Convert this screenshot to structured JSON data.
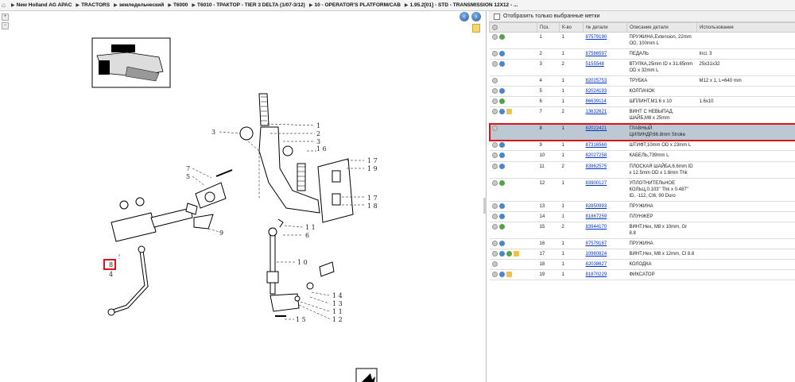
{
  "breadcrumb": [
    "New Holland AG APAC",
    "TRACTORS",
    "земледельческий",
    "T6000",
    "T6010 - ТРАКТОР - TIER 3 DELTA (1/07-3/12)",
    "10 - OPERATOR'S PLATFORM/CAB",
    "1.95.2[01] - STD - TRANSMISSION 12X12 - ..."
  ],
  "filter_label": "Отобразить только выбранные метки",
  "columns": [
    "Поз.",
    "К-во",
    "№ детали",
    "Описание детали",
    "Использование"
  ],
  "rows": [
    {
      "icons": [
        "info",
        "green"
      ],
      "pos": "1",
      "qty": "1",
      "part": "87579190",
      "desc": "ПРУЖИНА,Extension, 22mm OD, 100mm L",
      "use": ""
    },
    {
      "icons": [
        "info",
        "blue"
      ],
      "pos": "2",
      "qty": "1",
      "part": "87586597",
      "desc": "ПЕДАЛЬ",
      "use": "Incl. 3"
    },
    {
      "icons": [
        "info",
        "blue"
      ],
      "pos": "3",
      "qty": "2",
      "part": "5155548",
      "desc": "ВТУЛКА,25mm ID x 31.85mm OD x 32mm L",
      "use": "25x31x32"
    },
    {
      "icons": [
        "info"
      ],
      "pos": "4",
      "qty": "1",
      "part": "82025753",
      "desc": "ТРУБКА",
      "use": "M12 x 1, L=640 mm"
    },
    {
      "icons": [
        "info",
        "blue"
      ],
      "pos": "5",
      "qty": "1",
      "part": "82024193",
      "desc": "КОЛПАЧОК",
      "use": ""
    },
    {
      "icons": [
        "info",
        "green"
      ],
      "pos": "6",
      "qty": "1",
      "part": "86639114",
      "desc": "ШПЛИНТ,M1.6 x 10",
      "use": "1.6x10"
    },
    {
      "icons": [
        "info",
        "blue",
        "box"
      ],
      "pos": "7",
      "qty": "2",
      "part": "13632621",
      "desc": "ВИНТ С НЕВЫПАД. ШАЙБ,M8 x 25mm",
      "use": ""
    },
    {
      "icons": [
        "info"
      ],
      "pos": "8",
      "qty": "1",
      "part": "82022421",
      "desc": "ГЛАВНЫЙ ЦИЛИНДР,66.8mm Stroke",
      "use": "",
      "selected": true
    },
    {
      "icons": [
        "info",
        "blue"
      ],
      "pos": "9",
      "qty": "1",
      "part": "87316560",
      "desc": "ШТИФТ,10mm OD x 23mm L",
      "use": ""
    },
    {
      "icons": [
        "info",
        "blue"
      ],
      "pos": "10",
      "qty": "1",
      "part": "82027258",
      "desc": "КАБЕЛЬ,739mm L",
      "use": ""
    },
    {
      "icons": [
        "info",
        "blue"
      ],
      "pos": "11",
      "qty": "2",
      "part": "83962575",
      "desc": "ПЛОСКАЯ ШАЙБА,6.6mm ID x 12.5mm OD x 1.6mm Thk",
      "use": ""
    },
    {
      "icons": [
        "info",
        "green"
      ],
      "pos": "12",
      "qty": "1",
      "part": "83900127",
      "desc": "УПЛОТНИТЕЛЬНОЕ КОЛЬЦ,0.103\" Thk x 0.487\" ID, -112, CI6, 90 Duro",
      "use": ""
    },
    {
      "icons": [
        "info",
        "blue"
      ],
      "pos": "13",
      "qty": "1",
      "part": "82850993",
      "desc": "ПРУЖИНА",
      "use": ""
    },
    {
      "icons": [
        "info",
        "blue"
      ],
      "pos": "14",
      "qty": "1",
      "part": "81867259",
      "desc": "ПЛУНЖЕР",
      "use": ""
    },
    {
      "icons": [
        "info",
        "green"
      ],
      "pos": "15",
      "qty": "2",
      "part": "83944170",
      "desc": "ВИНТ,Hex, M8 x 10mm, Gr 8.8",
      "use": ""
    },
    {
      "icons": [
        "info",
        "blue"
      ],
      "pos": "16",
      "qty": "1",
      "part": "87579187",
      "desc": "ПРУЖИНА",
      "use": ""
    },
    {
      "icons": [
        "info",
        "blue",
        "green",
        "box"
      ],
      "pos": "17",
      "qty": "1",
      "part": "10960824",
      "desc": "ВИНТ,Hex, M8 x 12mm, Cl 8.8",
      "use": ""
    },
    {
      "icons": [
        "info"
      ],
      "pos": "18",
      "qty": "1",
      "part": "82038627",
      "desc": "КОЛОДКА",
      "use": ""
    },
    {
      "icons": [
        "info",
        "blue",
        "box"
      ],
      "pos": "19",
      "qty": "1",
      "part": "81870229",
      "desc": "ФИКСАТОР",
      "use": ""
    }
  ],
  "callouts": [
    "1",
    "2",
    "3",
    "3",
    "16",
    "17",
    "19",
    "17",
    "18",
    "7",
    "5",
    "9",
    "11",
    "6",
    "8",
    "4",
    "10",
    "14",
    "13",
    "11",
    "12",
    "15"
  ]
}
